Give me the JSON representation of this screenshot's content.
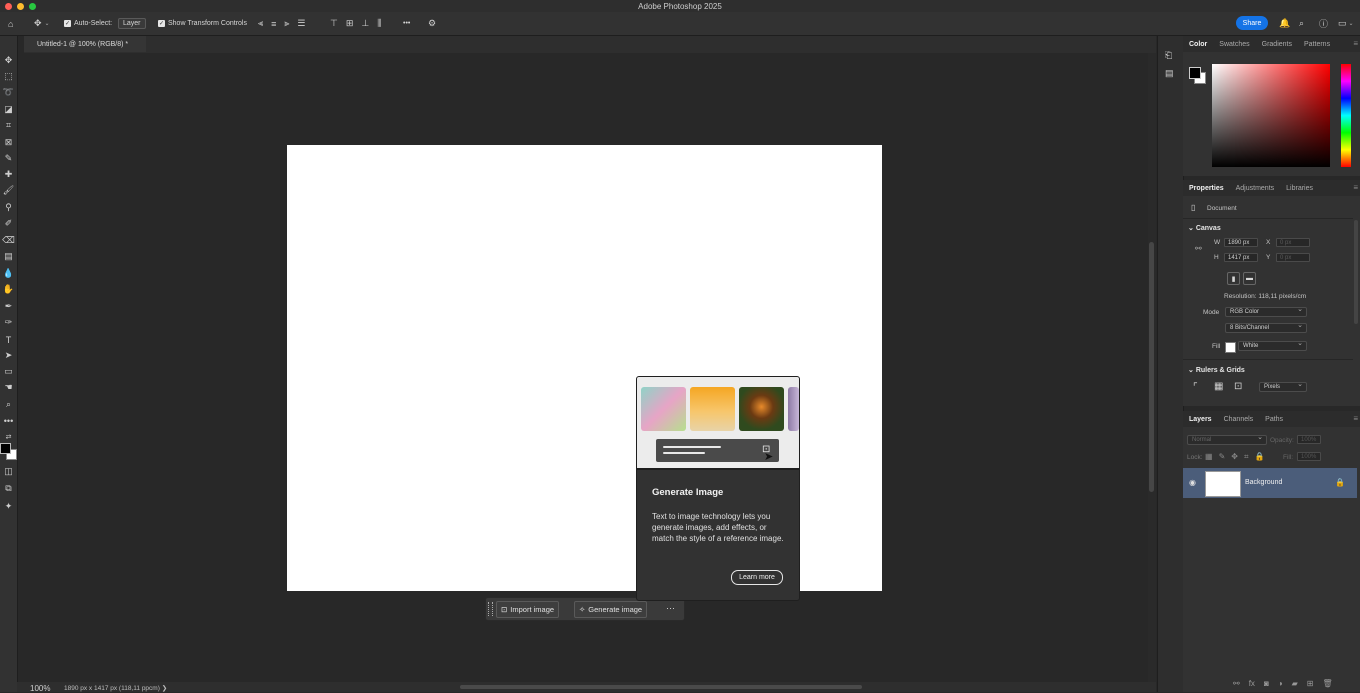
{
  "app": {
    "title": "Adobe Photoshop 2025"
  },
  "options_bar": {
    "auto_select_label": "Auto-Select:",
    "auto_select_value": "Layer",
    "transform_label": "Show Transform Controls",
    "share_label": "Share",
    "more_label": "•••"
  },
  "document": {
    "tab_label": "Untitled-1 @ 100% (RGB/8) *",
    "zoom": "100%",
    "info": "1890 px x 1417 px (118,11 ppcm)"
  },
  "panels": {
    "color_tabs": [
      "Color",
      "Swatches",
      "Gradients",
      "Patterns"
    ],
    "properties_tabs": [
      "Properties",
      "Adjustments",
      "Libraries"
    ],
    "properties": {
      "document_label": "Document",
      "canvas_label": "Canvas",
      "w_label": "W",
      "w_value": "1890 px",
      "h_label": "H",
      "h_value": "1417 px",
      "x_label": "X",
      "x_placeholder": "0 px",
      "y_label": "Y",
      "y_placeholder": "0 px",
      "resolution": "Resolution: 118,11 pixels/cm",
      "mode_label": "Mode",
      "mode_value": "RGB Color",
      "depth_value": "8 Bits/Channel",
      "fill_label": "Fill",
      "fill_value": "White",
      "rulers_label": "Rulers & Grids",
      "units_value": "Pixels"
    },
    "layers_tabs": [
      "Layers",
      "Channels",
      "Paths"
    ],
    "layers": {
      "blend_mode": "Normal",
      "opacity_label": "Opacity:",
      "opacity_value": "100%",
      "lock_label": "Lock:",
      "fill_label": "Fill:",
      "fill_value": "100%",
      "items": [
        {
          "name": "Background"
        }
      ]
    }
  },
  "context_bar": {
    "import_label": "Import image",
    "generate_label": "Generate image",
    "more_label": "···"
  },
  "popup": {
    "title": "Generate Image",
    "body": "Text to image technology lets you generate images, add effects, or match the style of a reference image.",
    "learn_more": "Learn more"
  },
  "colors": {
    "accent": "#1473e6",
    "canvas": "#ffffff",
    "layer_selected": "#4b5d7a"
  }
}
